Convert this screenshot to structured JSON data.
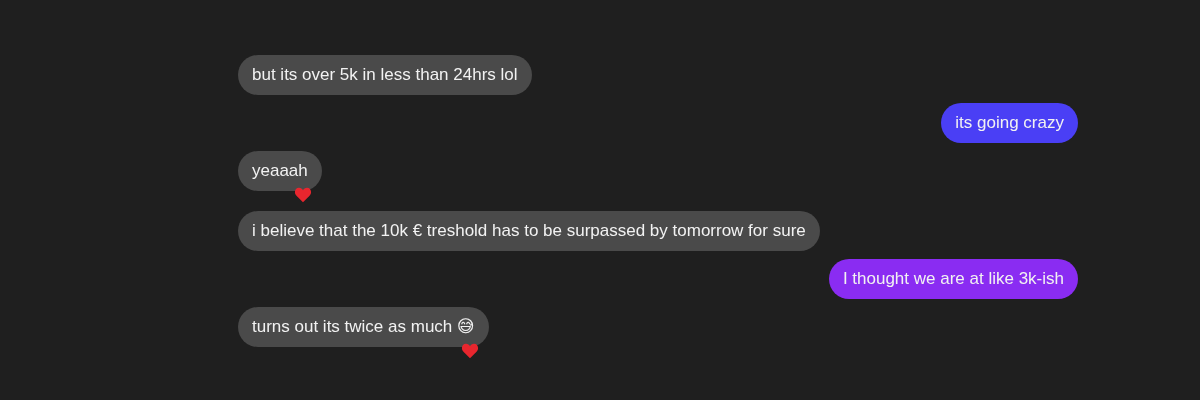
{
  "messages": [
    {
      "kind": "received",
      "text": "but its over 5k in less than 24hrs lol",
      "reacted": false
    },
    {
      "kind": "sent",
      "text": "its going crazy",
      "color": "#4a3ff5",
      "reacted": false
    },
    {
      "kind": "received",
      "text": "yeaaah",
      "reacted": true
    },
    {
      "kind": "received",
      "text": "i believe that the 10k € treshold has to be surpassed by tomorrow for sure",
      "reacted": false
    },
    {
      "kind": "sent",
      "text": "I thought we are at like 3k-ish",
      "color": "#8a2cf2",
      "reacted": false
    },
    {
      "kind": "received",
      "text": "turns out its twice as much 😅",
      "reacted": true
    }
  ]
}
